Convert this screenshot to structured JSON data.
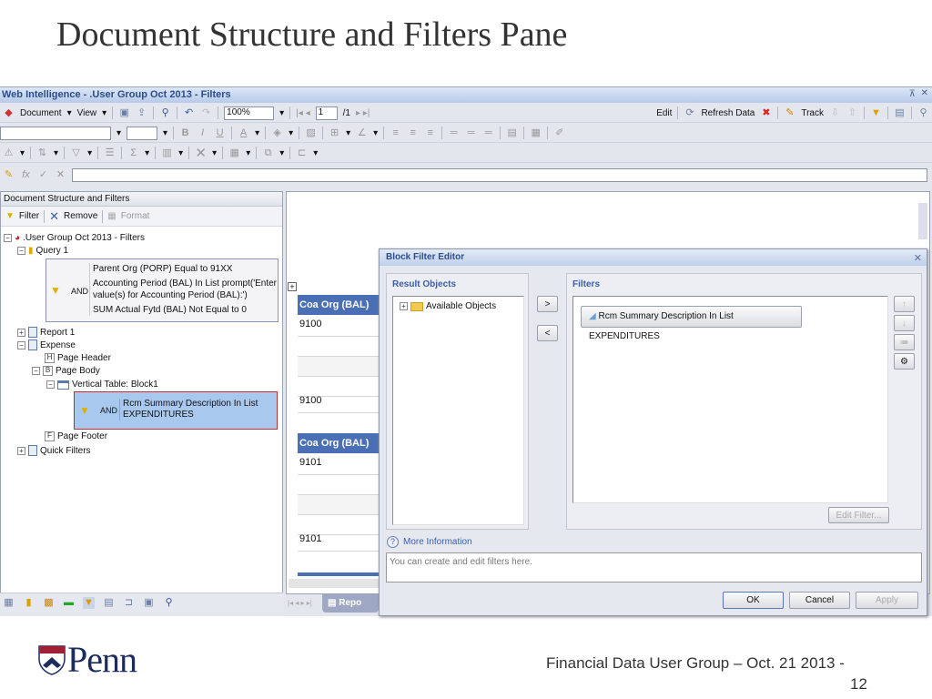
{
  "slide": {
    "title": "Document Structure and Filters Pane",
    "footer": "Financial Data User Group – Oct. 21 2013 -",
    "page": "12",
    "logo": "Penn"
  },
  "app": {
    "title": "Web Intelligence - .User Group Oct 2013 - Filters",
    "toolbar": {
      "document": "Document",
      "view": "View",
      "zoom": "100%",
      "page": "1",
      "page_total": "/1",
      "edit": "Edit",
      "refresh": "Refresh Data",
      "track": "Track"
    },
    "panel": {
      "title": "Document Structure and Filters",
      "filter": "Filter",
      "remove": "Remove",
      "format": "Format",
      "tree": {
        "root": ".User Group Oct 2013 - Filters",
        "query": "Query 1",
        "and": "AND",
        "query_filters": [
          "Parent Org (PORP) Equal to 91XX",
          "Accounting Period (BAL) In List prompt('Enter value(s) for Accounting Period (BAL):')",
          "SUM Actual Fytd (BAL) Not Equal to 0"
        ],
        "report1": "Report 1",
        "expense": "Expense",
        "page_header": "Page Header",
        "page_body": "Page Body",
        "vtable": "Vertical Table: Block1",
        "block_filter": "Rcm Summary Description In List EXPENDITURES",
        "page_footer": "Page Footer",
        "quick_filters": "Quick Filters"
      }
    },
    "report": {
      "header": "Coa Org (BAL)",
      "values": [
        "9100",
        "9100",
        "9101",
        "9101"
      ],
      "tab": "Repo"
    },
    "dialog": {
      "title": "Block Filter Editor",
      "result_objects": "Result Objects",
      "available": "Available Objects",
      "add": ">",
      "remove": "<",
      "filters": "Filters",
      "filter_item": "Rcm Summary Description In List EXPENDITURES",
      "edit_filter": "Edit Filter...",
      "more_info": "More Information",
      "info_text": "You can create and edit filters here.",
      "ok": "OK",
      "cancel": "Cancel",
      "apply": "Apply"
    }
  }
}
